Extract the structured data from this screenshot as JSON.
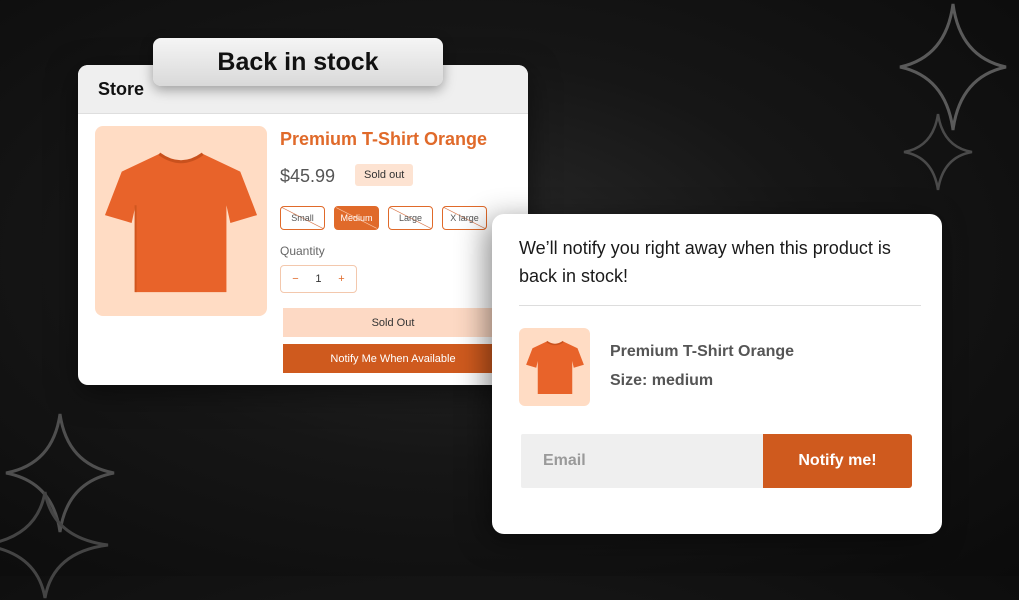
{
  "banner": {
    "title": "Back in stock"
  },
  "store": {
    "header": "Store",
    "product": {
      "name": "Premium T-Shirt Orange",
      "price": "$45.99",
      "badge": "Sold out",
      "image_icon": "tshirt-icon",
      "sizes": [
        {
          "label": "Small",
          "selected": false,
          "unavailable": true
        },
        {
          "label": "Medium",
          "selected": true,
          "unavailable": true
        },
        {
          "label": "Large",
          "selected": false,
          "unavailable": true
        },
        {
          "label": "X large",
          "selected": false,
          "unavailable": true
        }
      ],
      "quantity_label": "Quantity",
      "quantity": {
        "minus": "−",
        "value": "1",
        "plus": "+"
      },
      "sold_out_button": "Sold Out",
      "notify_button": "Notify Me When Available"
    }
  },
  "notify_card": {
    "message": "We’ll notify you right away when this product is back in stock!",
    "product_name": "Premium T-Shirt Orange",
    "product_size": "Size: medium",
    "email_placeholder": "Email",
    "email_value": "",
    "submit_label": "Notify me!"
  },
  "colors": {
    "accent": "#e06a2a",
    "button": "#cf5a1e",
    "soft_accent": "#ffdcc4",
    "background": "#111111"
  }
}
